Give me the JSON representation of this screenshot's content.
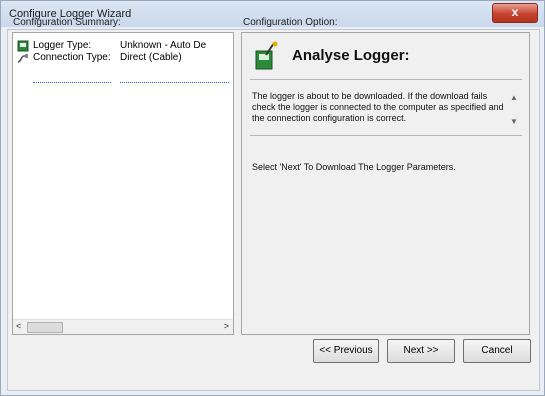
{
  "window": {
    "title": "Configure Logger Wizard",
    "close_label": "x"
  },
  "summary": {
    "heading": "Configuration Summary:",
    "rows": [
      {
        "name": "Logger Type:",
        "value": "Unknown - Auto De",
        "icon": "logger-icon"
      },
      {
        "name": "Connection Type:",
        "value": "Direct (Cable)",
        "icon": "cable-icon"
      }
    ],
    "scroll_left": "<",
    "scroll_right": ">"
  },
  "option": {
    "heading": "Configuration Option:",
    "title": "Analyse Logger:",
    "icon": "analyse-logger-icon",
    "description": "The logger is about to be downloaded. If the download fails check the logger is connected to the computer as specified and the connection configuration is correct.",
    "instruction": "Select 'Next' To Download The Logger Parameters."
  },
  "buttons": {
    "previous": "<< Previous",
    "next": "Next >>",
    "cancel": "Cancel"
  },
  "colors": {
    "accent": "#2a5fd0",
    "close": "#c7432f"
  }
}
